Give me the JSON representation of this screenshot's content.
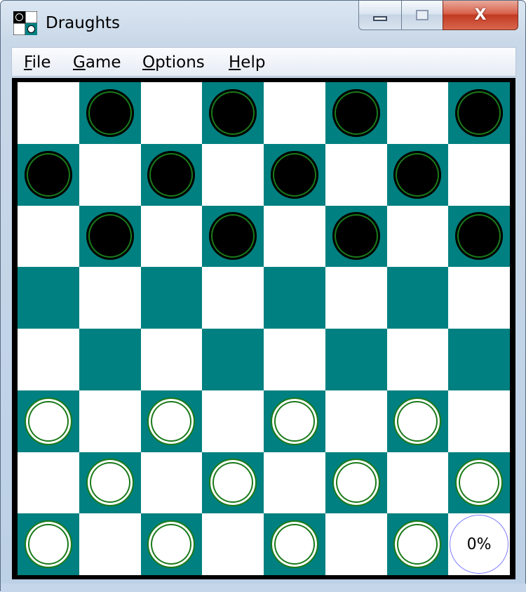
{
  "window": {
    "title": "Draughts",
    "icon": "draughts-app-icon",
    "controls": {
      "minimize_icon": "minimize-icon",
      "maximize_icon": "maximize-icon",
      "close_label": "X"
    }
  },
  "menu": [
    {
      "id": "file",
      "label": "File",
      "mnemonic": "F",
      "rest": "ile"
    },
    {
      "id": "game",
      "label": "Game",
      "mnemonic": "G",
      "rest": "ame"
    },
    {
      "id": "options",
      "label": "Options",
      "mnemonic": "O",
      "rest": "ptions"
    },
    {
      "id": "help",
      "label": "Help",
      "mnemonic": "H",
      "rest": "elp"
    }
  ],
  "colors": {
    "dark_square": "#008080",
    "light_square": "#ffffff",
    "black_piece": "#000000",
    "white_piece": "#ffffff",
    "piece_ring": "#1a7a1a",
    "status_ring": "#7d7dff"
  },
  "board": {
    "size": 8,
    "pieces": [
      ".b.b.b.b",
      "b.b.b.b.",
      ".b.b.b.b",
      "........",
      "........",
      "w.w.w.w.",
      ".w.w.w.w",
      "w.w.w.w."
    ],
    "status_text": "0%"
  }
}
